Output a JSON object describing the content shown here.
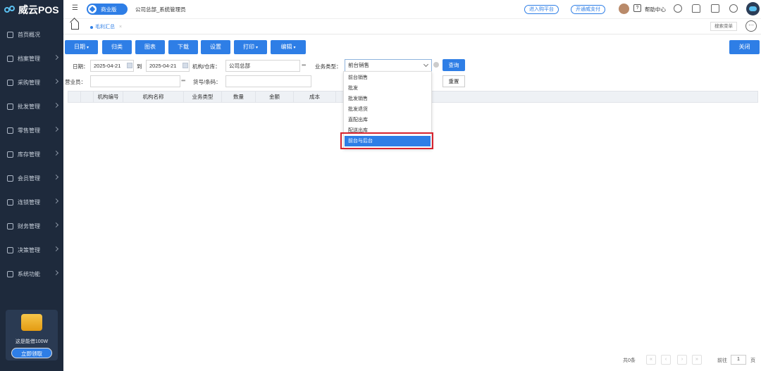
{
  "app": {
    "name": "威云POS"
  },
  "sidebar": {
    "items": [
      {
        "label": "首页概况"
      },
      {
        "label": "档案管理"
      },
      {
        "label": "采购管理"
      },
      {
        "label": "批发管理"
      },
      {
        "label": "零售管理"
      },
      {
        "label": "库存管理"
      },
      {
        "label": "会员管理"
      },
      {
        "label": "连锁管理"
      },
      {
        "label": "财务管理"
      },
      {
        "label": "决策管理"
      },
      {
        "label": "系统功能"
      }
    ],
    "promo_text": "这是能借100W",
    "promo_button": "立即领取"
  },
  "header": {
    "edition": "商业版",
    "org_user": "公司总部_系统管理员",
    "link_platform": "进入购平台",
    "link_pay": "开通威支付",
    "help": "帮助中心"
  },
  "tabs": {
    "active": "毛利汇总",
    "menu_search": "搜索菜单"
  },
  "toolbar": {
    "buttons": [
      "日期",
      "归类",
      "图表",
      "下载",
      "设置",
      "打印",
      "编辑"
    ],
    "close": "关闭"
  },
  "filters": {
    "date_label": "日期：",
    "date_from": "2025-04-21",
    "to_label": "到",
    "date_to": "2025-04-21",
    "org_label": "机构/仓库：",
    "org_value": "公司总部",
    "biz_type_label": "业务类型：",
    "biz_type_value": "前台销售",
    "query": "查询",
    "salesman_label": "营业员：",
    "sku_label": "货号/条码：",
    "reset": "重置"
  },
  "grid": {
    "columns": [
      "机构编号",
      "机构名称",
      "业务类型",
      "数量",
      "金额",
      "成本"
    ]
  },
  "dropdown": {
    "options": [
      "前台销售",
      "批发",
      "批发销售",
      "批发退货",
      "直配出库",
      "配送出库",
      "前台与后台"
    ],
    "highlighted": "前台与后台"
  },
  "pagination": {
    "total": "共0条",
    "goto_label": "前往",
    "page": "1",
    "page_suffix": "页"
  },
  "colors": {
    "accent": "#2e7ee6",
    "sidebar": "#1e2a3c",
    "highlight_border": "#d7232f"
  }
}
